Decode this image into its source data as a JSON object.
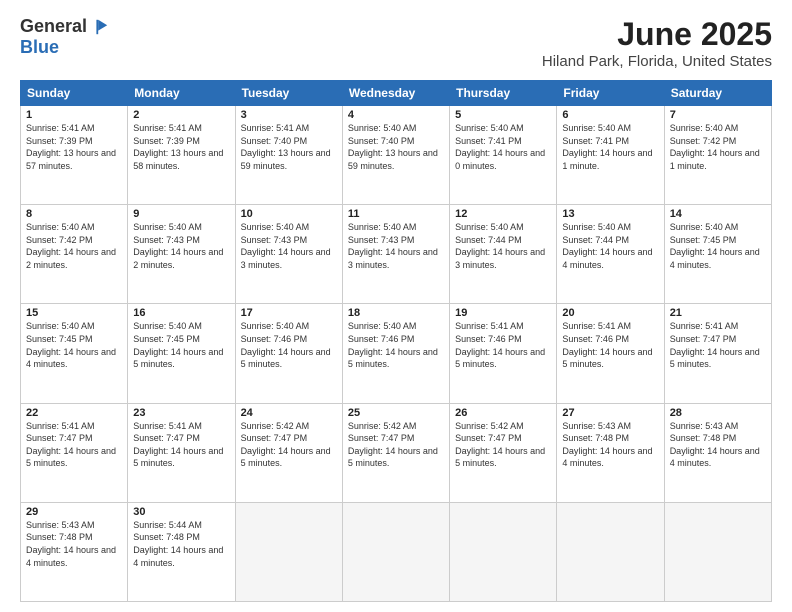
{
  "logo": {
    "general": "General",
    "blue": "Blue"
  },
  "header": {
    "title": "June 2025",
    "location": "Hiland Park, Florida, United States"
  },
  "weekdays": [
    "Sunday",
    "Monday",
    "Tuesday",
    "Wednesday",
    "Thursday",
    "Friday",
    "Saturday"
  ],
  "weeks": [
    [
      {
        "day": "1",
        "rise": "Sunrise: 5:41 AM",
        "set": "Sunset: 7:39 PM",
        "light": "Daylight: 13 hours and 57 minutes."
      },
      {
        "day": "2",
        "rise": "Sunrise: 5:41 AM",
        "set": "Sunset: 7:39 PM",
        "light": "Daylight: 13 hours and 58 minutes."
      },
      {
        "day": "3",
        "rise": "Sunrise: 5:41 AM",
        "set": "Sunset: 7:40 PM",
        "light": "Daylight: 13 hours and 59 minutes."
      },
      {
        "day": "4",
        "rise": "Sunrise: 5:40 AM",
        "set": "Sunset: 7:40 PM",
        "light": "Daylight: 13 hours and 59 minutes."
      },
      {
        "day": "5",
        "rise": "Sunrise: 5:40 AM",
        "set": "Sunset: 7:41 PM",
        "light": "Daylight: 14 hours and 0 minutes."
      },
      {
        "day": "6",
        "rise": "Sunrise: 5:40 AM",
        "set": "Sunset: 7:41 PM",
        "light": "Daylight: 14 hours and 1 minute."
      },
      {
        "day": "7",
        "rise": "Sunrise: 5:40 AM",
        "set": "Sunset: 7:42 PM",
        "light": "Daylight: 14 hours and 1 minute."
      }
    ],
    [
      {
        "day": "8",
        "rise": "Sunrise: 5:40 AM",
        "set": "Sunset: 7:42 PM",
        "light": "Daylight: 14 hours and 2 minutes."
      },
      {
        "day": "9",
        "rise": "Sunrise: 5:40 AM",
        "set": "Sunset: 7:43 PM",
        "light": "Daylight: 14 hours and 2 minutes."
      },
      {
        "day": "10",
        "rise": "Sunrise: 5:40 AM",
        "set": "Sunset: 7:43 PM",
        "light": "Daylight: 14 hours and 3 minutes."
      },
      {
        "day": "11",
        "rise": "Sunrise: 5:40 AM",
        "set": "Sunset: 7:43 PM",
        "light": "Daylight: 14 hours and 3 minutes."
      },
      {
        "day": "12",
        "rise": "Sunrise: 5:40 AM",
        "set": "Sunset: 7:44 PM",
        "light": "Daylight: 14 hours and 3 minutes."
      },
      {
        "day": "13",
        "rise": "Sunrise: 5:40 AM",
        "set": "Sunset: 7:44 PM",
        "light": "Daylight: 14 hours and 4 minutes."
      },
      {
        "day": "14",
        "rise": "Sunrise: 5:40 AM",
        "set": "Sunset: 7:45 PM",
        "light": "Daylight: 14 hours and 4 minutes."
      }
    ],
    [
      {
        "day": "15",
        "rise": "Sunrise: 5:40 AM",
        "set": "Sunset: 7:45 PM",
        "light": "Daylight: 14 hours and 4 minutes."
      },
      {
        "day": "16",
        "rise": "Sunrise: 5:40 AM",
        "set": "Sunset: 7:45 PM",
        "light": "Daylight: 14 hours and 5 minutes."
      },
      {
        "day": "17",
        "rise": "Sunrise: 5:40 AM",
        "set": "Sunset: 7:46 PM",
        "light": "Daylight: 14 hours and 5 minutes."
      },
      {
        "day": "18",
        "rise": "Sunrise: 5:40 AM",
        "set": "Sunset: 7:46 PM",
        "light": "Daylight: 14 hours and 5 minutes."
      },
      {
        "day": "19",
        "rise": "Sunrise: 5:41 AM",
        "set": "Sunset: 7:46 PM",
        "light": "Daylight: 14 hours and 5 minutes."
      },
      {
        "day": "20",
        "rise": "Sunrise: 5:41 AM",
        "set": "Sunset: 7:46 PM",
        "light": "Daylight: 14 hours and 5 minutes."
      },
      {
        "day": "21",
        "rise": "Sunrise: 5:41 AM",
        "set": "Sunset: 7:47 PM",
        "light": "Daylight: 14 hours and 5 minutes."
      }
    ],
    [
      {
        "day": "22",
        "rise": "Sunrise: 5:41 AM",
        "set": "Sunset: 7:47 PM",
        "light": "Daylight: 14 hours and 5 minutes."
      },
      {
        "day": "23",
        "rise": "Sunrise: 5:41 AM",
        "set": "Sunset: 7:47 PM",
        "light": "Daylight: 14 hours and 5 minutes."
      },
      {
        "day": "24",
        "rise": "Sunrise: 5:42 AM",
        "set": "Sunset: 7:47 PM",
        "light": "Daylight: 14 hours and 5 minutes."
      },
      {
        "day": "25",
        "rise": "Sunrise: 5:42 AM",
        "set": "Sunset: 7:47 PM",
        "light": "Daylight: 14 hours and 5 minutes."
      },
      {
        "day": "26",
        "rise": "Sunrise: 5:42 AM",
        "set": "Sunset: 7:47 PM",
        "light": "Daylight: 14 hours and 5 minutes."
      },
      {
        "day": "27",
        "rise": "Sunrise: 5:43 AM",
        "set": "Sunset: 7:48 PM",
        "light": "Daylight: 14 hours and 4 minutes."
      },
      {
        "day": "28",
        "rise": "Sunrise: 5:43 AM",
        "set": "Sunset: 7:48 PM",
        "light": "Daylight: 14 hours and 4 minutes."
      }
    ],
    [
      {
        "day": "29",
        "rise": "Sunrise: 5:43 AM",
        "set": "Sunset: 7:48 PM",
        "light": "Daylight: 14 hours and 4 minutes."
      },
      {
        "day": "30",
        "rise": "Sunrise: 5:44 AM",
        "set": "Sunset: 7:48 PM",
        "light": "Daylight: 14 hours and 4 minutes."
      },
      null,
      null,
      null,
      null,
      null
    ]
  ]
}
